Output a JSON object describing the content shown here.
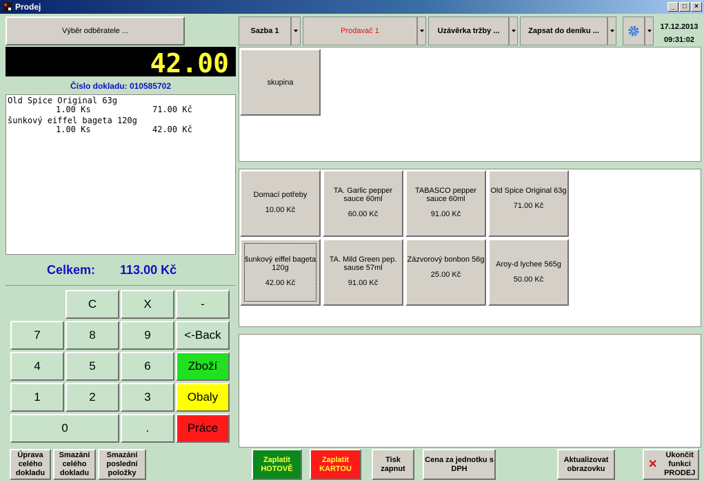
{
  "window": {
    "title": "Prodej"
  },
  "customer_button": "Výběr odběratele ...",
  "display_total": "42.00",
  "document_label": "Číslo dokladu: 010585702",
  "receipt_lines": [
    {
      "name": "Old Spice Original 63g",
      "qty": "1.00 Ks",
      "price": "71.00 Kč"
    },
    {
      "name": "šunkový eiffel bageta 120g",
      "qty": "1.00 Ks",
      "price": "42.00 Kč"
    }
  ],
  "total": {
    "label": "Celkem:",
    "value": "113.00 Kč"
  },
  "toolbar": {
    "rate": "Sazba 1",
    "seller": "Prodavač 1",
    "closing": "Uzávěrka tržby ...",
    "journal": "Zapsat do deníku ...",
    "date": "17.12.2013",
    "time": "09:31:02"
  },
  "groups": [
    "skupina"
  ],
  "products": [
    {
      "name": "Domací potřeby",
      "price": "10.00 Kč"
    },
    {
      "name": "TA. Garlic pepper sauce 60ml",
      "price": "60.00 Kč"
    },
    {
      "name": "TABASCO pepper sauce 60ml",
      "price": "91.00 Kč"
    },
    {
      "name": "Old Spice Original 63g",
      "price": "71.00 Kč"
    },
    {
      "name": "šunkový eiffel bageta 120g",
      "price": "42.00 Kč"
    },
    {
      "name": "TA. Mild Green pep. sause 57ml",
      "price": "91.00 Kč"
    },
    {
      "name": "Zázvorový bonbon 56g",
      "price": "25.00 Kč"
    },
    {
      "name": "Aroy-d lychee 565g",
      "price": "50.00 Kč"
    }
  ],
  "keypad": {
    "c": "C",
    "x": "X",
    "minus": "-",
    "k7": "7",
    "k8": "8",
    "k9": "9",
    "back": "<-Back",
    "k4": "4",
    "k5": "5",
    "k6": "6",
    "goods": "Zboží",
    "k1": "1",
    "k2": "2",
    "k3": "3",
    "packaging": "Obaly",
    "k0": "0",
    "dot": ".",
    "work": "Práce"
  },
  "keypad_colors": {
    "goods": "#20e020",
    "packaging": "#ffff00",
    "work": "#ff1a1a"
  },
  "bottom": {
    "edit_doc": "Úprava celého dokladu",
    "delete_doc": "Smazání celého dokladu",
    "delete_last": "Smazání poslední položky",
    "pay_cash": "Zaplatit HOTOVĚ",
    "pay_card": "Zaplatit KARTOU",
    "print": "Tisk zapnut",
    "unit_price": "Cena za jednotku s DPH",
    "refresh": "Aktualizovat obrazovku",
    "exit": "Ukončit funkci PRODEJ"
  },
  "icons": {
    "settings": "gear-icon",
    "exit": "close-x-icon"
  }
}
